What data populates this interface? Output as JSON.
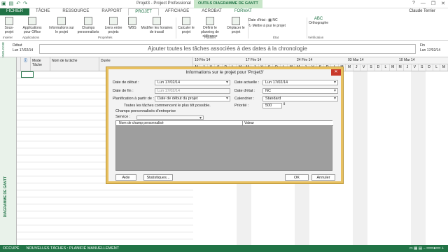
{
  "window": {
    "title": "Projet3 - Project Professional",
    "context_tab_group": "OUTILS DIAGRAMME DE GANTT",
    "user": "Claude Terrier",
    "controls": [
      "?",
      "—",
      "❐",
      "✕"
    ]
  },
  "tabs": [
    "FICHIER",
    "TÂCHE",
    "RESSOURCE",
    "RAPPORT",
    "PROJET",
    "AFFICHAGE",
    "ACROBAT",
    "FORMAT"
  ],
  "ribbon": {
    "buttons": [
      "Sous-projet",
      "Applications pour Office",
      "Informations sur le projet",
      "Champs personnalisés",
      "Liens entre projets",
      "WBS",
      "Modifier les horaires de travail",
      "Calculer le projet",
      "Définir le planning de référence",
      "Déplacer le projet",
      "Orthographe"
    ],
    "groups": [
      "Insérer",
      "Applications",
      "Propriétés",
      "Planifier",
      "État",
      "Vérification"
    ],
    "status_date_label": "Date d'état :",
    "status_date_value": "NC",
    "update_project": "Mettre à jour le projet",
    "spell_label": "ABC"
  },
  "timeline": {
    "side_label": "CHRONOLOGIE",
    "start_label": "Début",
    "start_date": "Lun 17/02/14",
    "placeholder": "Ajouter toutes les tâches associées à des dates à la chronologie",
    "end_label": "Fin",
    "end_date": "Lun 17/02/14"
  },
  "grid": {
    "columns": [
      "Mode Tâche",
      "Nom de la tâche",
      "Durée"
    ],
    "side_label": "DIAGRAMME DE GANTT"
  },
  "chart": {
    "weeks": [
      "10 Fév 14",
      "17 Fév 14",
      "24 Fév 14",
      "03 Mar 14",
      "10 Mar 14"
    ],
    "days": [
      "M",
      "J",
      "V",
      "S",
      "D",
      "L",
      "M",
      "M",
      "J",
      "V",
      "S",
      "D",
      "L",
      "M",
      "M",
      "J",
      "V",
      "S",
      "D",
      "L",
      "M",
      "M",
      "J",
      "V",
      "S",
      "D",
      "L",
      "M",
      "M",
      "J",
      "V",
      "S",
      "D",
      "L",
      "M"
    ]
  },
  "dialog": {
    "title": "Informations sur le projet pour 'Projet3'",
    "start_label": "Date de début :",
    "start_value": "Lun 17/02/14",
    "current_label": "Date actuelle :",
    "current_value": "Lun 17/02/14",
    "end_label": "Date de fin :",
    "end_value": "Lun 17/02/14",
    "status_label": "Date d'état :",
    "status_value": "NC",
    "schedule_label": "Planification à partir de :",
    "schedule_value": "Date de début du projet",
    "calendar_label": "Calendrier :",
    "calendar_value": "Standard",
    "note": "Toutes les tâches commencent le plus tôt possible.",
    "priority_label": "Priorité :",
    "priority_value": "500",
    "custom_fields_label": "Champs personnalisés d'entreprise",
    "service_label": "Service :",
    "table_col1": "Nom de champ personnalisé",
    "table_col2": "Valeur",
    "help": "Aide",
    "stats": "Statistiques...",
    "ok": "OK",
    "cancel": "Annuler"
  },
  "statusbar": {
    "ready": "OCCUPÉ",
    "new_tasks": "NOUVELLES TÂCHES : PLANIFIÉ MANUELLEMENT"
  },
  "colors": {
    "accent": "#217346",
    "dialog_border": "#e8c060",
    "close": "#c8382a"
  }
}
